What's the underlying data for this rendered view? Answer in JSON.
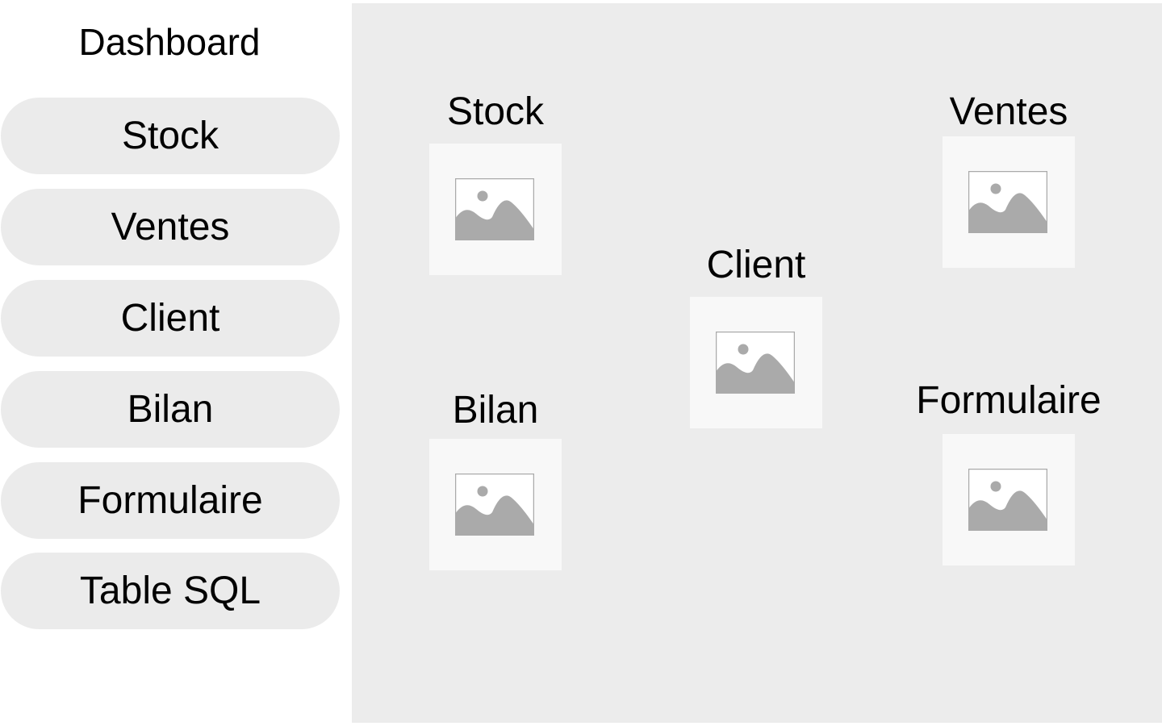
{
  "sidebar": {
    "title": "Dashboard",
    "items": [
      {
        "label": "Stock"
      },
      {
        "label": "Ventes"
      },
      {
        "label": "Client"
      },
      {
        "label": "Bilan"
      },
      {
        "label": "Formulaire"
      },
      {
        "label": "Table SQL"
      }
    ]
  },
  "main": {
    "tiles": [
      {
        "label": "Stock",
        "icon": "image-placeholder-icon"
      },
      {
        "label": "Ventes",
        "icon": "image-placeholder-icon"
      },
      {
        "label": "Client",
        "icon": "image-placeholder-icon"
      },
      {
        "label": "Bilan",
        "icon": "image-placeholder-icon"
      },
      {
        "label": "Formulaire",
        "icon": "image-placeholder-icon"
      }
    ]
  },
  "colors": {
    "main_background": "#ececec",
    "nav_button": "#ebebeb",
    "tile_background": "#f8f8f8",
    "icon_gray": "#aaaaaa"
  }
}
